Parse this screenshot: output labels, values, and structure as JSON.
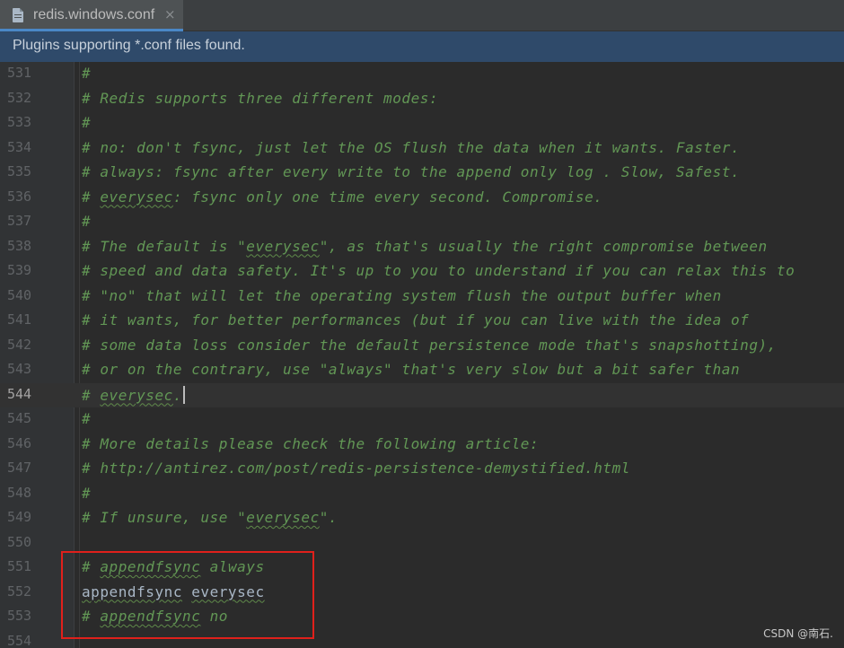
{
  "tab": {
    "label": "redis.windows.conf",
    "close_glyph": "×",
    "icon": "config-file-icon"
  },
  "banner": {
    "text": "Plugins supporting *.conf files found."
  },
  "editor": {
    "current_line": "544",
    "lines": [
      {
        "n": "531",
        "text": "#",
        "kind": "comment"
      },
      {
        "n": "532",
        "text": "# Redis supports three different modes:",
        "kind": "comment"
      },
      {
        "n": "533",
        "text": "#",
        "kind": "comment"
      },
      {
        "n": "534",
        "text": "# no: don't fsync, just let the OS flush the data when it wants. Faster.",
        "kind": "comment"
      },
      {
        "n": "535",
        "text": "# always: fsync after every write to the append only log . Slow, Safest.",
        "kind": "comment"
      },
      {
        "n": "536",
        "text": "# everysec: fsync only one time every second. Compromise.",
        "kind": "comment"
      },
      {
        "n": "537",
        "text": "#",
        "kind": "comment"
      },
      {
        "n": "538",
        "text": "# The default is \"everysec\", as that's usually the right compromise between",
        "kind": "comment"
      },
      {
        "n": "539",
        "text": "# speed and data safety. It's up to you to understand if you can relax this to",
        "kind": "comment"
      },
      {
        "n": "540",
        "text": "# \"no\" that will let the operating system flush the output buffer when",
        "kind": "comment"
      },
      {
        "n": "541",
        "text": "# it wants, for better performances (but if you can live with the idea of",
        "kind": "comment"
      },
      {
        "n": "542",
        "text": "# some data loss consider the default persistence mode that's snapshotting),",
        "kind": "comment"
      },
      {
        "n": "543",
        "text": "# or on the contrary, use \"always\" that's very slow but a bit safer than",
        "kind": "comment"
      },
      {
        "n": "544",
        "text": "# everysec.",
        "kind": "comment"
      },
      {
        "n": "545",
        "text": "#",
        "kind": "comment"
      },
      {
        "n": "546",
        "text": "# More details please check the following article:",
        "kind": "comment"
      },
      {
        "n": "547",
        "text": "# http://antirez.com/post/redis-persistence-demystified.html",
        "kind": "comment"
      },
      {
        "n": "548",
        "text": "#",
        "kind": "comment"
      },
      {
        "n": "549",
        "text": "# If unsure, use \"everysec\".",
        "kind": "comment"
      },
      {
        "n": "550",
        "text": "",
        "kind": "comment"
      },
      {
        "n": "551",
        "text": "# appendfsync always",
        "kind": "comment"
      },
      {
        "n": "552",
        "text": "appendfsync everysec",
        "kind": "plain"
      },
      {
        "n": "553",
        "text": "# appendfsync no",
        "kind": "comment"
      },
      {
        "n": "554",
        "text": "",
        "kind": "comment"
      }
    ]
  },
  "spellcheck_words": [
    "everysec",
    "appendfsync"
  ],
  "colors": {
    "comment": "#629755",
    "code": "#a9b7c6",
    "highlight_box": "#e0201b",
    "banner": "#2f4a6a"
  },
  "watermark": "CSDN @南石."
}
